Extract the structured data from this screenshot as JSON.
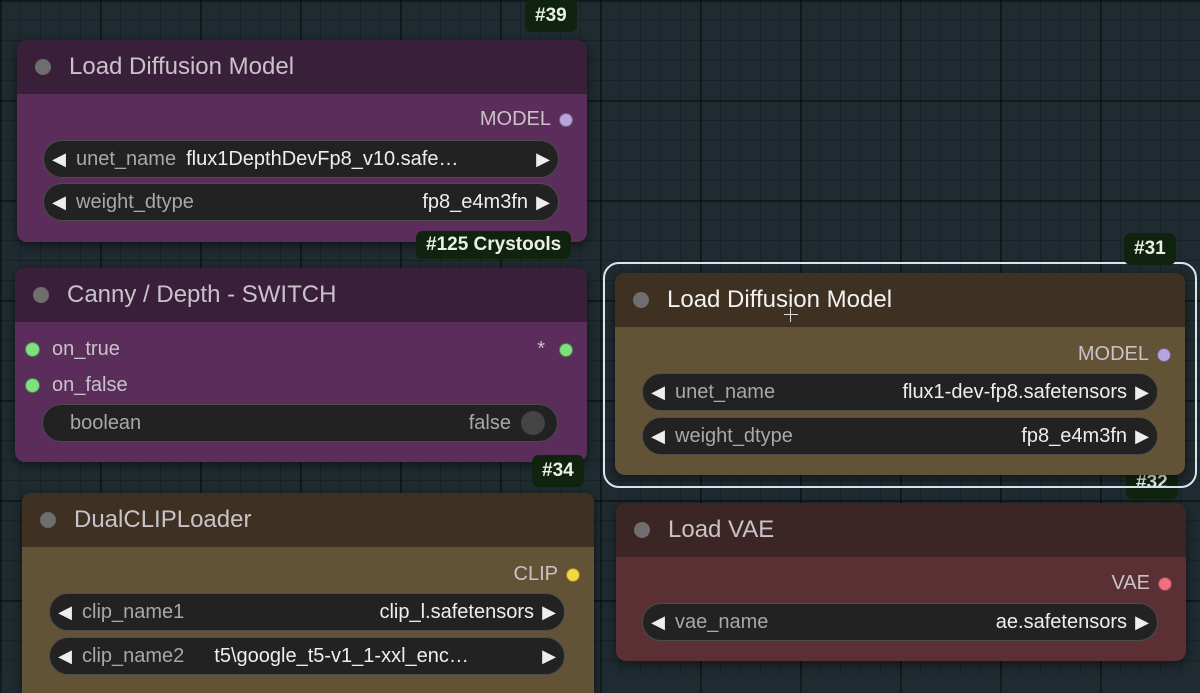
{
  "nodes": {
    "load_diffusion_model_39": {
      "badge": "#39",
      "title": "Load Diffusion Model",
      "output": "MODEL",
      "widgets": [
        {
          "label": "unet_name",
          "value": "flux1DepthDevFp8_v10.safe…"
        },
        {
          "label": "weight_dtype",
          "value": "fp8_e4m3fn"
        }
      ]
    },
    "crystools_125": {
      "badge": "#125 Crystools"
    },
    "switch_node": {
      "title": "Canny / Depth - SWITCH",
      "inputs": [
        "on_true",
        "on_false"
      ],
      "output": "*",
      "toggle": {
        "label": "boolean",
        "value": "false"
      }
    },
    "dual_clip_loader_34": {
      "badge": "#34",
      "title": "DualCLIPLoader",
      "output": "CLIP",
      "widgets": [
        {
          "label": "clip_name1",
          "value": "clip_l.safetensors"
        },
        {
          "label": "clip_name2",
          "value": "t5\\google_t5-v1_1-xxl_enc…"
        }
      ]
    },
    "load_diffusion_model_31": {
      "badge": "#31",
      "title": "Load Diffusion Model",
      "output": "MODEL",
      "widgets": [
        {
          "label": "unet_name",
          "value": "flux1-dev-fp8.safetensors"
        },
        {
          "label": "weight_dtype",
          "value": "fp8_e4m3fn"
        }
      ]
    },
    "load_vae_32": {
      "badge": "#32",
      "title": "Load VAE",
      "output": "VAE",
      "widgets": [
        {
          "label": "vae_name",
          "value": "ae.safetensors"
        }
      ]
    }
  },
  "arrows": {
    "left": "◀",
    "right": "▶"
  },
  "colors": {
    "canvas": "#1f2b30",
    "purple_header": "#3a1f3a",
    "purple_body": "#5a2d5a",
    "olive_header": "#3e3122",
    "olive_body": "#625236",
    "red_header": "#3b2525",
    "red_body": "#5a3035",
    "model_port": "#b9a3dc",
    "clip_port": "#f2d642",
    "vae_port": "#ee6f7d",
    "link_port": "#7ee07e"
  }
}
